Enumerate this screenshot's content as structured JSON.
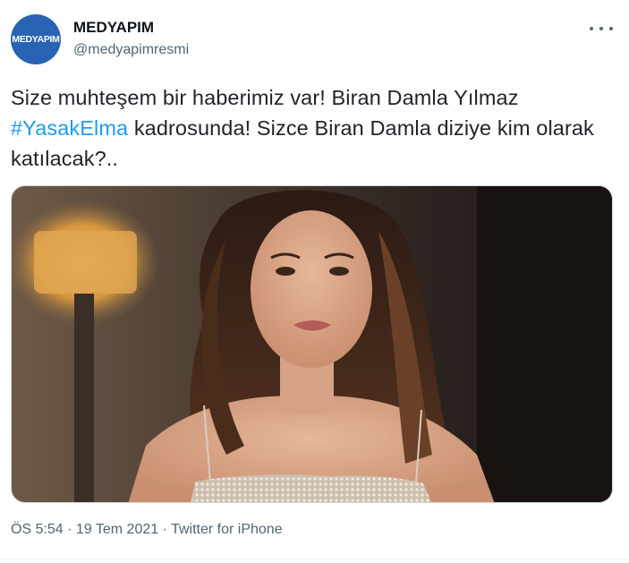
{
  "author": {
    "display_name": "MEDYAPIM",
    "handle": "@medyapimresmi",
    "avatar_text": "MEDYAPIM"
  },
  "tweet": {
    "text_part1": "Size muhteşem bir haberimiz var! Biran Damla Yılmaz ",
    "hashtag": "#YasakElma",
    "text_part2": " kadrosunda! Sizce Biran Damla diziye kim olarak katılacak?.."
  },
  "meta": {
    "time": "ÖS 5:54",
    "separator": " · ",
    "date": "19 Tem 2021",
    "source": "Twitter for iPhone"
  },
  "colors": {
    "accent": "#1d9bf0",
    "avatar_bg": "#2a63b3",
    "secondary_text": "#536471"
  },
  "icons": {
    "more": "more-horizontal-icon"
  }
}
